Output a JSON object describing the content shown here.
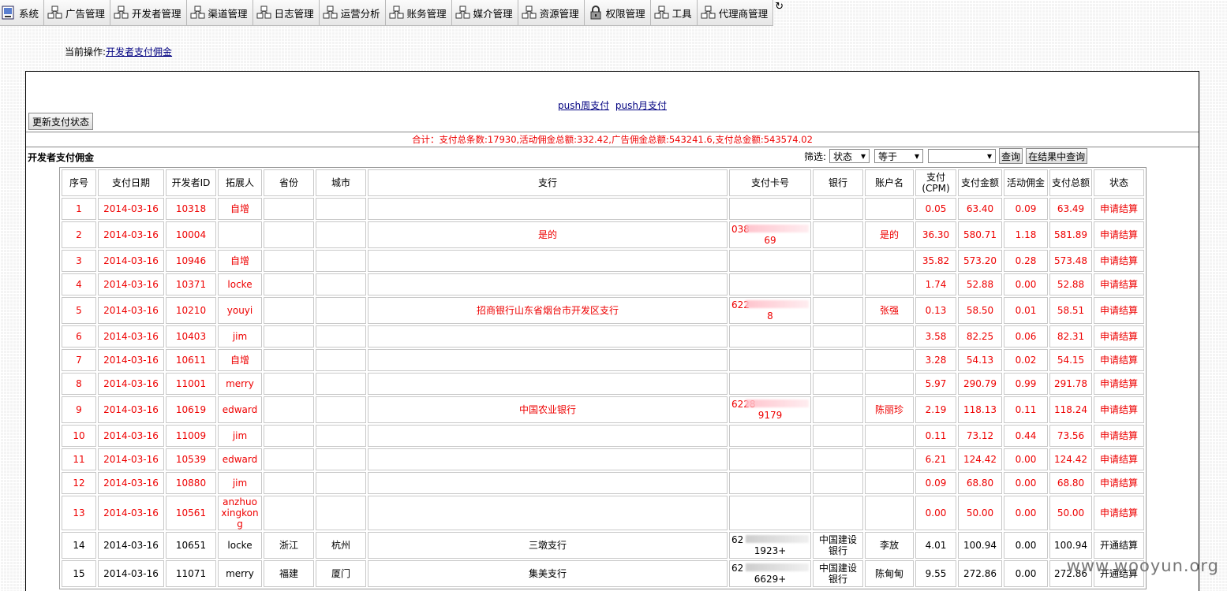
{
  "menu": [
    {
      "label": "系统",
      "icon": "system-icon"
    },
    {
      "label": "广告管理",
      "icon": "modules-icon"
    },
    {
      "label": "开发者管理",
      "icon": "modules-icon"
    },
    {
      "label": "渠道管理",
      "icon": "modules-icon"
    },
    {
      "label": "日志管理",
      "icon": "modules-icon"
    },
    {
      "label": "运营分析",
      "icon": "modules-icon"
    },
    {
      "label": "账务管理",
      "icon": "modules-icon"
    },
    {
      "label": "媒介管理",
      "icon": "modules-icon"
    },
    {
      "label": "资源管理",
      "icon": "modules-icon"
    },
    {
      "label": "权限管理",
      "icon": "lock-icon"
    },
    {
      "label": "工具",
      "icon": "modules-icon"
    },
    {
      "label": "代理商管理",
      "icon": "modules-icon"
    }
  ],
  "breadcrumb": {
    "prefix": "当前操作:",
    "link": "开发者支付佣金"
  },
  "push_links": [
    "push周支付",
    "push月支付"
  ],
  "update_button": "更新支付状态",
  "summary": "合计：支付总条数:17930,活动佣金总额:332.42,广告佣金总额:543241.6,支付总金额:543574.02",
  "table_title": "开发者支付佣金",
  "filter": {
    "label": "筛选:",
    "field": "状态",
    "operator": "等于",
    "value": "",
    "query_button": "查询",
    "refine_button": "在结果中查询"
  },
  "columns": [
    "序号",
    "支付日期",
    "开发者ID",
    "拓展人",
    "省份",
    "城市",
    "支行",
    "支付卡号",
    "银行",
    "账户名",
    "支付(CPM)",
    "支付金额",
    "活动佣金",
    "支付总额",
    "状态"
  ],
  "rows": [
    {
      "no": "1",
      "date": "2014-03-16",
      "dev_id": "10318",
      "promoter": "自增",
      "province": "",
      "city": "",
      "branch": "",
      "card": "",
      "bank": "",
      "account": "",
      "cpm": "0.05",
      "amount": "63.40",
      "activity": "0.09",
      "total": "63.49",
      "status": "申请结算",
      "style": "red"
    },
    {
      "no": "2",
      "date": "2014-03-16",
      "dev_id": "10004",
      "promoter": "",
      "province": "",
      "city": "",
      "branch": "是的",
      "card": "69",
      "card_prefix": "038",
      "bank": "",
      "account": "是的",
      "cpm": "36.30",
      "amount": "580.71",
      "activity": "1.18",
      "total": "581.89",
      "status": "申请结算",
      "style": "red"
    },
    {
      "no": "3",
      "date": "2014-03-16",
      "dev_id": "10946",
      "promoter": "自增",
      "province": "",
      "city": "",
      "branch": "",
      "card": "",
      "bank": "",
      "account": "",
      "cpm": "35.82",
      "amount": "573.20",
      "activity": "0.28",
      "total": "573.48",
      "status": "申请结算",
      "style": "red"
    },
    {
      "no": "4",
      "date": "2014-03-16",
      "dev_id": "10371",
      "promoter": "locke",
      "province": "",
      "city": "",
      "branch": "",
      "card": "",
      "bank": "",
      "account": "",
      "cpm": "1.74",
      "amount": "52.88",
      "activity": "0.00",
      "total": "52.88",
      "status": "申请结算",
      "style": "red"
    },
    {
      "no": "5",
      "date": "2014-03-16",
      "dev_id": "10210",
      "promoter": "youyi",
      "province": "",
      "city": "",
      "branch": "招商银行山东省烟台市开发区支行",
      "card": "8",
      "card_prefix": "622",
      "bank": "",
      "account": "张强",
      "cpm": "0.13",
      "amount": "58.50",
      "activity": "0.01",
      "total": "58.51",
      "status": "申请结算",
      "style": "red"
    },
    {
      "no": "6",
      "date": "2014-03-16",
      "dev_id": "10403",
      "promoter": "jim",
      "province": "",
      "city": "",
      "branch": "",
      "card": "",
      "bank": "",
      "account": "",
      "cpm": "3.58",
      "amount": "82.25",
      "activity": "0.06",
      "total": "82.31",
      "status": "申请结算",
      "style": "red"
    },
    {
      "no": "7",
      "date": "2014-03-16",
      "dev_id": "10611",
      "promoter": "自增",
      "province": "",
      "city": "",
      "branch": "",
      "card": "",
      "bank": "",
      "account": "",
      "cpm": "3.28",
      "amount": "54.13",
      "activity": "0.02",
      "total": "54.15",
      "status": "申请结算",
      "style": "red"
    },
    {
      "no": "8",
      "date": "2014-03-16",
      "dev_id": "11001",
      "promoter": "merry",
      "province": "",
      "city": "",
      "branch": "",
      "card": "",
      "bank": "",
      "account": "",
      "cpm": "5.97",
      "amount": "290.79",
      "activity": "0.99",
      "total": "291.78",
      "status": "申请结算",
      "style": "red"
    },
    {
      "no": "9",
      "date": "2014-03-16",
      "dev_id": "10619",
      "promoter": "edward",
      "province": "",
      "city": "",
      "branch": "中国农业银行",
      "card": "9179",
      "card_prefix": "6228",
      "bank": "",
      "account": "陈丽珍",
      "cpm": "2.19",
      "amount": "118.13",
      "activity": "0.11",
      "total": "118.24",
      "status": "申请结算",
      "style": "red"
    },
    {
      "no": "10",
      "date": "2014-03-16",
      "dev_id": "11009",
      "promoter": "jim",
      "province": "",
      "city": "",
      "branch": "",
      "card": "",
      "bank": "",
      "account": "",
      "cpm": "0.11",
      "amount": "73.12",
      "activity": "0.44",
      "total": "73.56",
      "status": "申请结算",
      "style": "red"
    },
    {
      "no": "11",
      "date": "2014-03-16",
      "dev_id": "10539",
      "promoter": "edward",
      "province": "",
      "city": "",
      "branch": "",
      "card": "",
      "bank": "",
      "account": "",
      "cpm": "6.21",
      "amount": "124.42",
      "activity": "0.00",
      "total": "124.42",
      "status": "申请结算",
      "style": "red"
    },
    {
      "no": "12",
      "date": "2014-03-16",
      "dev_id": "10880",
      "promoter": "jim",
      "province": "",
      "city": "",
      "branch": "",
      "card": "",
      "bank": "",
      "account": "",
      "cpm": "0.09",
      "amount": "68.80",
      "activity": "0.00",
      "total": "68.80",
      "status": "申请结算",
      "style": "red"
    },
    {
      "no": "13",
      "date": "2014-03-16",
      "dev_id": "10561",
      "promoter": "anzhuoxingkong",
      "province": "",
      "city": "",
      "branch": "",
      "card": "",
      "bank": "",
      "account": "",
      "cpm": "0.00",
      "amount": "50.00",
      "activity": "0.00",
      "total": "50.00",
      "status": "申请结算",
      "style": "red"
    },
    {
      "no": "14",
      "date": "2014-03-16",
      "dev_id": "10651",
      "promoter": "locke",
      "province": "浙江",
      "city": "杭州",
      "branch": "三墩支行",
      "card": "1923+",
      "card_prefix": "62",
      "bank": "中国建设银行",
      "account": "李放",
      "cpm": "4.01",
      "amount": "100.94",
      "activity": "0.00",
      "total": "100.94",
      "status": "开通结算",
      "style": "black"
    },
    {
      "no": "15",
      "date": "2014-03-16",
      "dev_id": "11071",
      "promoter": "merry",
      "province": "福建",
      "city": "厦门",
      "branch": "集美支行",
      "card": "6629+",
      "card_prefix": "62",
      "bank": "中国建设银行",
      "account": "陈甸甸",
      "cpm": "9.55",
      "amount": "272.86",
      "activity": "0.00",
      "total": "272.86",
      "status": "开通结算",
      "style": "black"
    }
  ],
  "watermark": "www.wooyun.org"
}
